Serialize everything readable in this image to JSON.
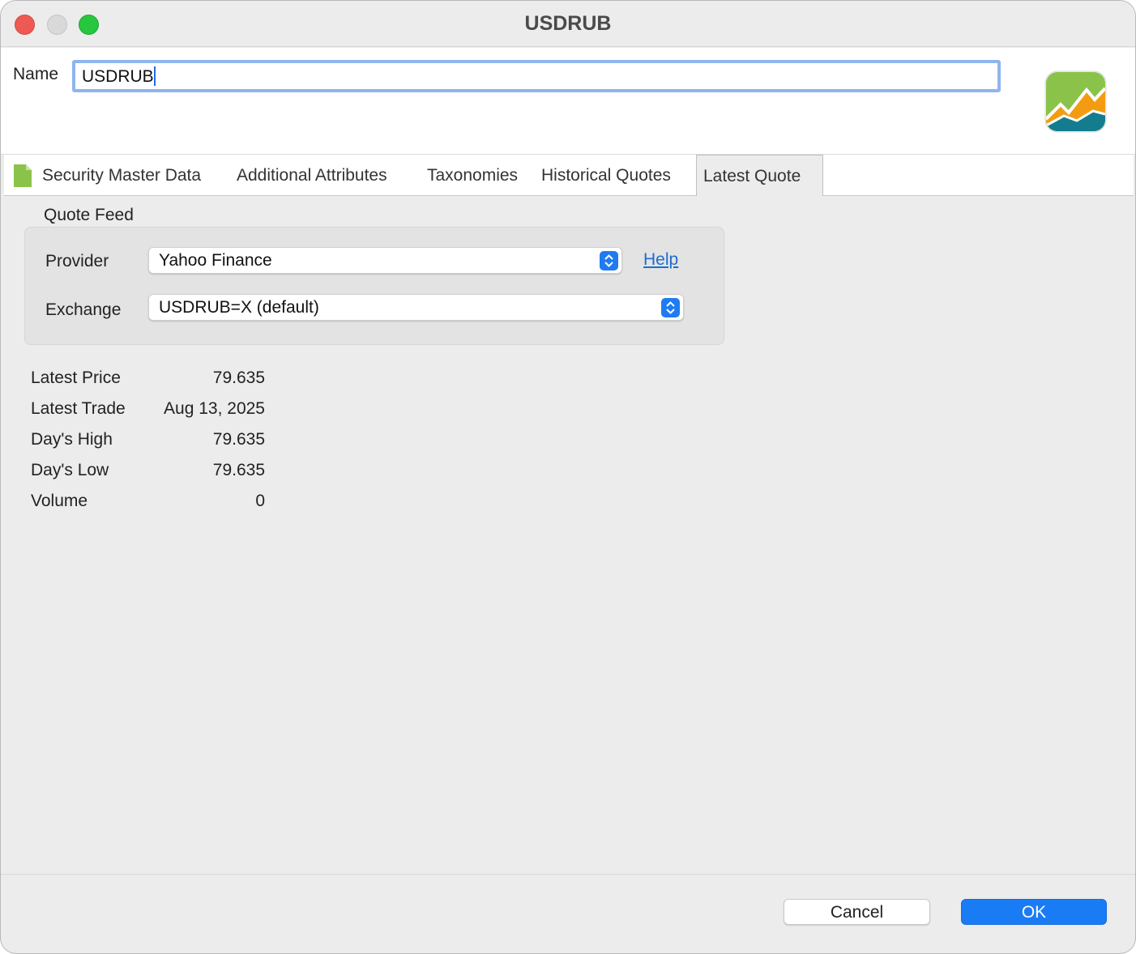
{
  "window": {
    "title": "USDRUB"
  },
  "header": {
    "name_label": "Name",
    "name_value": "USDRUB",
    "app_icon": "portfolio-performance-icon"
  },
  "tabs": [
    {
      "label": "Security Master Data",
      "icon": "document-icon",
      "active": false
    },
    {
      "label": "Additional Attributes",
      "active": false
    },
    {
      "label": "Taxonomies",
      "active": false
    },
    {
      "label": "Historical Quotes",
      "active": false
    },
    {
      "label": "Latest Quote",
      "active": true
    }
  ],
  "quote_feed": {
    "title": "Quote Feed",
    "provider_label": "Provider",
    "provider_value": "Yahoo Finance",
    "help_label": "Help",
    "exchange_label": "Exchange",
    "exchange_value": "USDRUB=X (default)"
  },
  "latest_quote": [
    {
      "label": "Latest Price",
      "value": "79.635"
    },
    {
      "label": "Latest Trade",
      "value": "Aug 13, 2025"
    },
    {
      "label": "Day's High",
      "value": "79.635"
    },
    {
      "label": "Day's Low",
      "value": "79.635"
    },
    {
      "label": "Volume",
      "value": "0"
    }
  ],
  "buttons": {
    "cancel": "Cancel",
    "ok": "OK"
  },
  "colors": {
    "accent": "#1a7cf5",
    "link": "#1f6cd1",
    "focus_ring": "#8fb5ee",
    "close": "#ee5a52",
    "maximize": "#27c63f"
  }
}
